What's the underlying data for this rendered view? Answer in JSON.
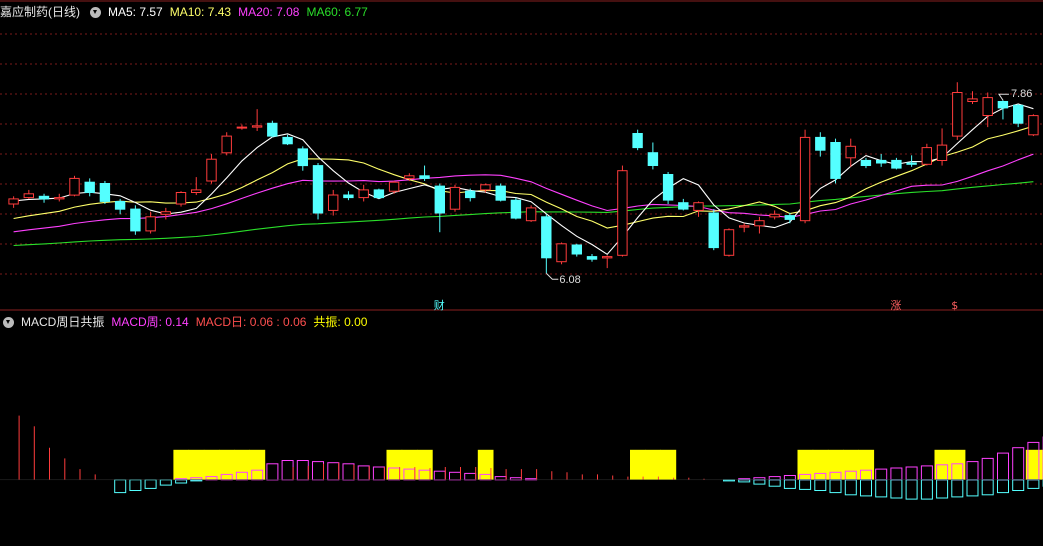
{
  "panel_top": {
    "title": "嘉应制药(日线)",
    "ma5": "MA5: 7.57",
    "ma10": "MA10: 7.43",
    "ma20": "MA20: 7.08",
    "ma60": "MA60: 6.77"
  },
  "panel_bottom": {
    "title": "MACD周日共振",
    "macd_week": "MACD周: 0.14",
    "macd_day": "MACD日: 0.06 : 0.06",
    "resonance": "共振: 0.00"
  },
  "colors": {
    "up": "#ff3c3c",
    "down": "#54ffff",
    "ma5": "#ffffff",
    "ma10": "#ffff6a",
    "ma20": "#ff40ff",
    "ma60": "#2adf2a",
    "macd_week": "#ff40ff",
    "macd_day_pos": "#ff3c3c",
    "macd_day_neg": "#54ffff",
    "resonance": "#ffff00",
    "grid": "#7a1a1a"
  },
  "chart_data": [
    {
      "type": "candlestick",
      "title": "嘉应制药(日线)",
      "ylim": [
        5.9,
        8.1
      ],
      "series_names": [
        "MA5",
        "MA10",
        "MA20",
        "MA60"
      ],
      "annotations": [
        {
          "text": "7.86",
          "index": 65,
          "kind": "high"
        },
        {
          "text": "6.08",
          "index": 35,
          "kind": "low"
        },
        {
          "text": "财",
          "index": 28,
          "kind": "tag",
          "color": "#54ffff"
        },
        {
          "text": "涨",
          "index": 58,
          "kind": "tag",
          "color": "#ff6060"
        },
        {
          "text": "$",
          "index": 62,
          "kind": "tag",
          "color": "#ff6060"
        }
      ],
      "candles": [
        [
          6.68,
          6.74,
          6.65,
          6.72
        ],
        [
          6.73,
          6.79,
          6.72,
          6.76
        ],
        [
          6.74,
          6.76,
          6.69,
          6.72
        ],
        [
          6.72,
          6.76,
          6.7,
          6.73
        ],
        [
          6.75,
          6.9,
          6.74,
          6.88
        ],
        [
          6.85,
          6.88,
          6.74,
          6.77
        ],
        [
          6.84,
          6.86,
          6.68,
          6.7
        ],
        [
          6.7,
          6.72,
          6.6,
          6.64
        ],
        [
          6.64,
          6.67,
          6.44,
          6.47
        ],
        [
          6.47,
          6.62,
          6.45,
          6.58
        ],
        [
          6.6,
          6.65,
          6.56,
          6.62
        ],
        [
          6.68,
          6.78,
          6.66,
          6.77
        ],
        [
          6.77,
          6.89,
          6.75,
          6.79
        ],
        [
          6.86,
          7.07,
          6.84,
          7.03
        ],
        [
          7.08,
          7.24,
          7.06,
          7.21
        ],
        [
          7.28,
          7.3,
          7.26,
          7.28
        ],
        [
          7.28,
          7.42,
          7.25,
          7.29
        ],
        [
          7.31,
          7.33,
          7.2,
          7.21
        ],
        [
          7.2,
          7.22,
          7.14,
          7.15
        ],
        [
          7.11,
          7.13,
          6.94,
          6.98
        ],
        [
          6.98,
          7.0,
          6.56,
          6.61
        ],
        [
          6.63,
          6.79,
          6.59,
          6.75
        ],
        [
          6.75,
          6.78,
          6.71,
          6.73
        ],
        [
          6.73,
          6.83,
          6.7,
          6.79
        ],
        [
          6.79,
          6.8,
          6.72,
          6.73
        ],
        [
          6.78,
          6.86,
          6.76,
          6.85
        ],
        [
          6.88,
          6.92,
          6.86,
          6.9
        ],
        [
          6.9,
          6.98,
          6.86,
          6.88
        ],
        [
          6.82,
          6.84,
          6.46,
          6.61
        ],
        [
          6.64,
          6.83,
          6.62,
          6.81
        ],
        [
          6.78,
          6.8,
          6.7,
          6.73
        ],
        [
          6.79,
          6.84,
          6.77,
          6.83
        ],
        [
          6.82,
          6.84,
          6.7,
          6.71
        ],
        [
          6.71,
          6.73,
          6.56,
          6.57
        ],
        [
          6.55,
          6.67,
          6.54,
          6.65
        ],
        [
          6.58,
          6.6,
          6.14,
          6.26
        ],
        [
          6.23,
          6.38,
          6.21,
          6.37
        ],
        [
          6.36,
          6.37,
          6.27,
          6.29
        ],
        [
          6.27,
          6.29,
          6.23,
          6.25
        ],
        [
          6.26,
          6.28,
          6.18,
          6.27
        ],
        [
          6.28,
          6.98,
          6.27,
          6.94
        ],
        [
          7.23,
          7.26,
          7.1,
          7.12
        ],
        [
          7.08,
          7.16,
          6.95,
          6.98
        ],
        [
          6.91,
          6.93,
          6.68,
          6.71
        ],
        [
          6.69,
          6.72,
          6.63,
          6.64
        ],
        [
          6.63,
          6.7,
          6.58,
          6.69
        ],
        [
          6.61,
          6.64,
          6.32,
          6.34
        ],
        [
          6.28,
          6.49,
          6.27,
          6.48
        ],
        [
          6.5,
          6.53,
          6.46,
          6.51
        ],
        [
          6.51,
          6.58,
          6.45,
          6.55
        ],
        [
          6.58,
          6.63,
          6.56,
          6.6
        ],
        [
          6.59,
          6.61,
          6.53,
          6.56
        ],
        [
          6.55,
          7.26,
          6.53,
          7.2
        ],
        [
          7.2,
          7.24,
          7.05,
          7.1
        ],
        [
          7.16,
          7.19,
          6.84,
          6.88
        ],
        [
          7.04,
          7.19,
          6.97,
          7.13
        ],
        [
          7.02,
          7.04,
          6.96,
          6.98
        ],
        [
          7.02,
          7.07,
          6.97,
          7.0
        ],
        [
          7.02,
          7.04,
          6.95,
          6.96
        ],
        [
          7.0,
          7.06,
          6.97,
          6.99
        ],
        [
          6.99,
          7.15,
          6.98,
          7.12
        ],
        [
          7.02,
          7.27,
          6.98,
          7.14
        ],
        [
          7.21,
          7.63,
          7.18,
          7.55
        ],
        [
          7.48,
          7.56,
          7.46,
          7.5
        ],
        [
          7.37,
          7.55,
          7.28,
          7.51
        ],
        [
          7.48,
          7.49,
          7.34,
          7.43
        ],
        [
          7.45,
          7.46,
          7.28,
          7.31
        ],
        [
          7.22,
          7.38,
          7.21,
          7.37
        ]
      ]
    },
    {
      "type": "bar",
      "title": "MACD周日共振",
      "series_names": [
        "MACD周",
        "MACD日",
        "共振"
      ],
      "ylim": [
        -0.06,
        0.14
      ],
      "macd_week": [
        0,
        0,
        0,
        0,
        0,
        0,
        0,
        0,
        0,
        0,
        0,
        0.001,
        0.002,
        0.003,
        0.005,
        0.007,
        0.009,
        0.015,
        0.018,
        0.018,
        0.017,
        0.016,
        0.015,
        0.013,
        0.012,
        0.011,
        0.01,
        0.009,
        0.008,
        0.007,
        0.006,
        0.005,
        0.003,
        0.002,
        0.001,
        0.0,
        -0.001,
        -0.003,
        -0.004,
        -0.005,
        -0.006,
        -0.006,
        -0.007,
        -0.007,
        -0.005,
        -0.004,
        -0.002,
        0.0,
        0.001,
        0.002,
        0.003,
        0.004,
        0.005,
        0.006,
        0.007,
        0.008,
        0.009,
        0.01,
        0.011,
        0.012,
        0.013,
        0.014,
        0.015,
        0.017,
        0.02,
        0.025,
        0.03,
        0.035,
        0.04,
        0.05
      ],
      "macd_day": [
        0.06,
        0.05,
        0.03,
        0.02,
        0.01,
        0.005,
        0,
        -0.012,
        -0.01,
        -0.008,
        -0.005,
        -0.003,
        -0.001,
        0,
        0,
        0,
        0,
        0,
        0.012,
        0.013,
        0.015,
        0.016,
        0.014,
        0.013,
        0.012,
        0.012,
        0.012,
        0.011,
        0.012,
        0.012,
        0.012,
        0.011,
        0.01,
        0.01,
        0.01,
        0.008,
        0.007,
        0.005,
        0.005,
        0.004,
        0.003,
        0.003,
        0.003,
        0.002,
        0.002,
        0.001,
        0.0,
        -0.001,
        -0.002,
        -0.004,
        -0.006,
        -0.008,
        -0.009,
        -0.01,
        -0.012,
        -0.014,
        -0.015,
        -0.016,
        -0.017,
        -0.018,
        -0.018,
        -0.017,
        -0.016,
        -0.015,
        -0.014,
        -0.012,
        -0.01,
        -0.008,
        -0.006,
        -0.004
      ],
      "resonance": [
        0,
        0,
        0,
        0,
        0,
        0,
        0,
        0,
        0,
        0,
        0,
        1,
        1,
        1,
        1,
        1,
        1,
        0,
        0,
        0,
        0,
        0,
        0,
        0,
        0,
        1,
        1,
        1,
        0,
        0,
        0,
        1,
        0,
        0,
        0,
        0,
        0,
        0,
        0,
        0,
        0,
        1,
        1,
        1,
        0,
        0,
        0,
        0,
        0,
        0,
        0,
        0,
        1,
        1,
        1,
        1,
        1,
        0,
        0,
        0,
        0,
        1,
        1,
        0,
        0,
        0,
        0,
        1,
        1,
        0
      ],
      "resonance_value": 0.0
    }
  ]
}
